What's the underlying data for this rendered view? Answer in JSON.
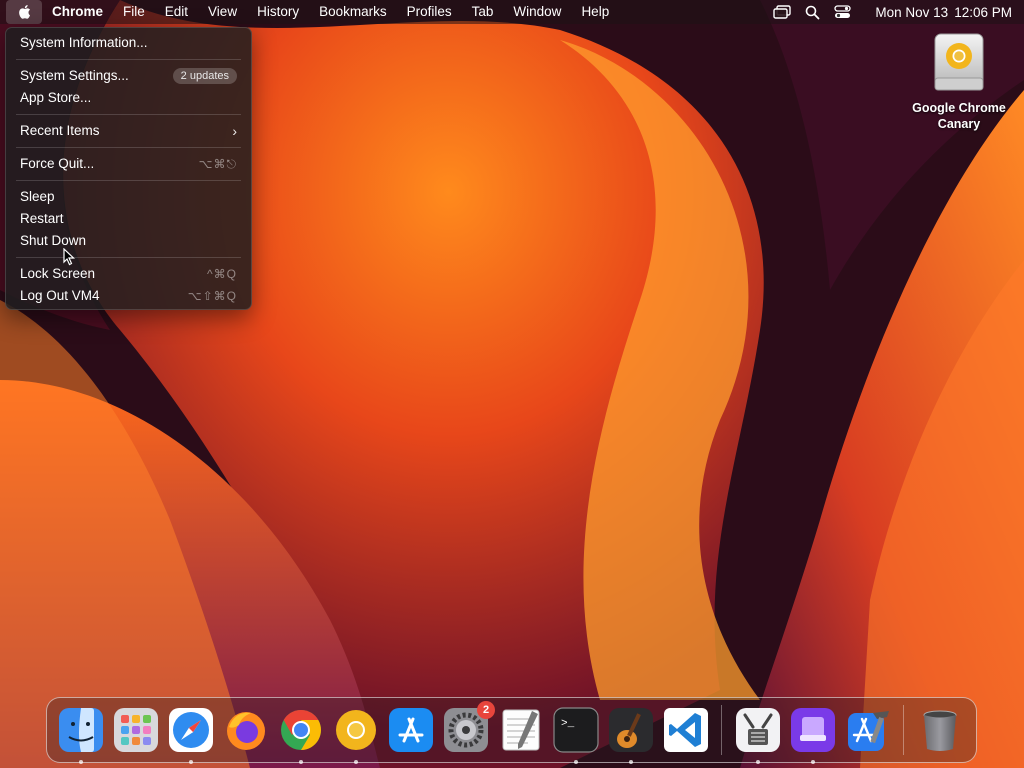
{
  "menubar": {
    "app_name": "Chrome",
    "menus": [
      "File",
      "Edit",
      "View",
      "History",
      "Bookmarks",
      "Profiles",
      "Tab",
      "Window",
      "Help"
    ],
    "clock": {
      "date": "Mon Nov 13",
      "time": "12:06 PM"
    },
    "icons": [
      "apple-logo-icon",
      "screen-mirroring-icon",
      "spotlight-search-icon",
      "control-center-icon"
    ]
  },
  "apple_menu": {
    "system_information": "System Information...",
    "system_settings": "System Settings...",
    "updates_badge": "2 updates",
    "app_store": "App Store...",
    "recent_items": "Recent Items",
    "recent_items_chevron": "›",
    "force_quit": "Force Quit...",
    "force_quit_shortcut": "⌥⌘⎋",
    "sleep": "Sleep",
    "restart": "Restart",
    "shut_down": "Shut Down",
    "lock_screen": "Lock Screen",
    "lock_screen_shortcut": "^⌘Q",
    "log_out": "Log Out VM4",
    "log_out_shortcut": "⌥⇧⌘Q"
  },
  "desktop_icon": {
    "line1": "Google Chrome",
    "line2": "Canary",
    "icon": "disk-image-icon"
  },
  "dock": {
    "apps": [
      {
        "name": "finder-icon",
        "running": true
      },
      {
        "name": "launchpad-icon",
        "running": false
      },
      {
        "name": "safari-icon",
        "running": true
      },
      {
        "name": "firefox-icon",
        "running": false
      },
      {
        "name": "chrome-icon",
        "running": true
      },
      {
        "name": "chrome-canary-icon",
        "running": true
      },
      {
        "name": "app-store-icon",
        "running": false
      },
      {
        "name": "system-settings-icon",
        "running": false,
        "badge": "2"
      },
      {
        "name": "textedit-icon",
        "running": false
      },
      {
        "name": "terminal-icon",
        "running": true
      },
      {
        "name": "garageband-icon",
        "running": true
      },
      {
        "name": "vscode-icon",
        "running": false
      },
      {
        "name": "system-information-icon",
        "running": true
      },
      {
        "name": "apple-configurator-icon",
        "running": true
      },
      {
        "name": "xcode-icon",
        "running": false
      },
      {
        "name": "trash-icon",
        "running": false
      }
    ],
    "settings_badge": "2",
    "terminal_prompt": ">_"
  },
  "colors": {
    "accent_orange": "#ff7a1a",
    "badge_red": "#e8453c",
    "menu_bg": "#201e20"
  }
}
